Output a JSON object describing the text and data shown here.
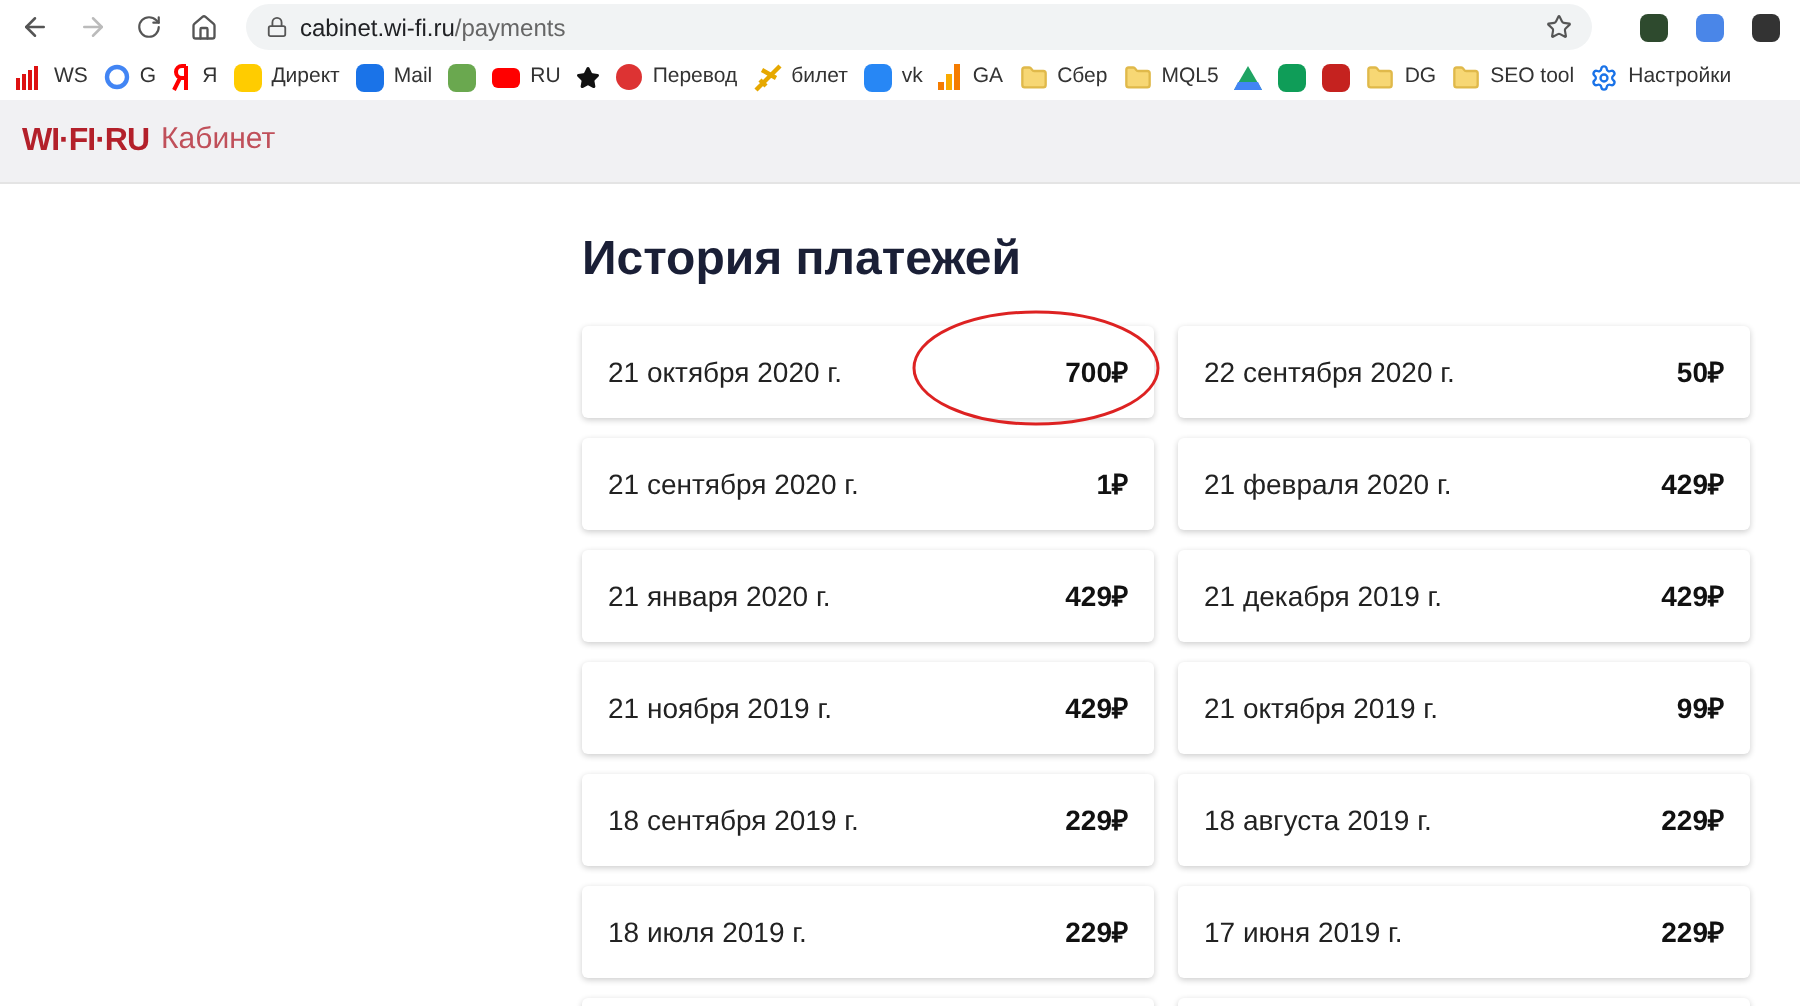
{
  "browser": {
    "url_host": "cabinet.wi-fi.ru",
    "url_path": "/payments",
    "bookmarks": [
      "WS",
      "G",
      "Я",
      "Директ",
      "Mail",
      "RU",
      "Перевод",
      "билет",
      "vk",
      "GA",
      "Сбер",
      "MQL5",
      "DG",
      "SEO tool",
      "Настройки"
    ]
  },
  "header": {
    "logo": "WI·FI·RU",
    "section": "Кабинет"
  },
  "page": {
    "title": "История платежей",
    "payments": [
      {
        "date": "21 октября 2020 г.",
        "amount": "700₽",
        "circled": true
      },
      {
        "date": "22 сентября 2020 г.",
        "amount": "50₽",
        "circled": false
      },
      {
        "date": "21 сентября 2020 г.",
        "amount": "1₽",
        "circled": false
      },
      {
        "date": "21 февраля 2020 г.",
        "amount": "429₽",
        "circled": false
      },
      {
        "date": "21 января 2020 г.",
        "amount": "429₽",
        "circled": false
      },
      {
        "date": "21 декабря 2019 г.",
        "amount": "429₽",
        "circled": false
      },
      {
        "date": "21 ноября 2019 г.",
        "amount": "429₽",
        "circled": false
      },
      {
        "date": "21 октября 2019 г.",
        "amount": "99₽",
        "circled": false
      },
      {
        "date": "18 сентября 2019 г.",
        "amount": "229₽",
        "circled": false
      },
      {
        "date": "18 августа 2019 г.",
        "amount": "229₽",
        "circled": false
      },
      {
        "date": "18 июля 2019 г.",
        "amount": "229₽",
        "circled": false
      },
      {
        "date": "17 июня 2019 г.",
        "amount": "229₽",
        "circled": false
      }
    ]
  }
}
